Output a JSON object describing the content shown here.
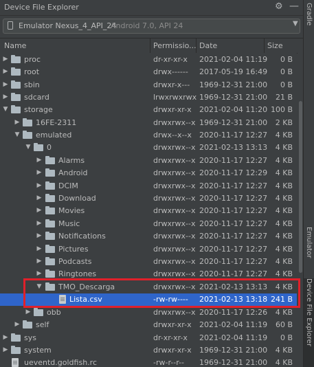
{
  "panel": {
    "title": "Device File Explorer"
  },
  "device": {
    "name": "Emulator Nexus_4_API_24",
    "detail": "Android 7.0, API 24"
  },
  "columns": {
    "name": "Name",
    "permissions": "Permissio...",
    "date": "Date",
    "size": "Size"
  },
  "rows": [
    {
      "name": "proc",
      "perm": "dr-xr-xr-x",
      "date": "2021-02-04 11:19",
      "size": "0 B"
    },
    {
      "name": "root",
      "perm": "drwx------",
      "date": "2017-05-19 16:49",
      "size": "0 B"
    },
    {
      "name": "sbin",
      "perm": "drwxr-x---",
      "date": "1969-12-31 21:00",
      "size": "0 B"
    },
    {
      "name": "sdcard",
      "perm": "lrwxrwxrwx",
      "date": "1969-12-31 21:00",
      "size": "21 B"
    },
    {
      "name": "storage",
      "perm": "drwxr-xr-x",
      "date": "2021-02-04 11:20",
      "size": "100 B"
    },
    {
      "name": "16FE-2311",
      "perm": "drwxrwx--x",
      "date": "1969-12-31 21:00",
      "size": "2 KB"
    },
    {
      "name": "emulated",
      "perm": "drwx--x--x",
      "date": "2020-11-17 12:27",
      "size": "4 KB"
    },
    {
      "name": "0",
      "perm": "drwxrwx--x",
      "date": "2021-02-13 13:13",
      "size": "4 KB"
    },
    {
      "name": "Alarms",
      "perm": "drwxrwx--x",
      "date": "2020-11-17 12:27",
      "size": "4 KB"
    },
    {
      "name": "Android",
      "perm": "drwxrwx--x",
      "date": "2020-11-17 12:29",
      "size": "4 KB"
    },
    {
      "name": "DCIM",
      "perm": "drwxrwx--x",
      "date": "2020-11-17 12:27",
      "size": "4 KB"
    },
    {
      "name": "Download",
      "perm": "drwxrwx--x",
      "date": "2020-11-17 12:27",
      "size": "4 KB"
    },
    {
      "name": "Movies",
      "perm": "drwxrwx--x",
      "date": "2020-11-17 12:27",
      "size": "4 KB"
    },
    {
      "name": "Music",
      "perm": "drwxrwx--x",
      "date": "2020-11-17 12:27",
      "size": "4 KB"
    },
    {
      "name": "Notifications",
      "perm": "drwxrwx--x",
      "date": "2020-11-17 12:27",
      "size": "4 KB"
    },
    {
      "name": "Pictures",
      "perm": "drwxrwx--x",
      "date": "2020-11-17 12:27",
      "size": "4 KB"
    },
    {
      "name": "Podcasts",
      "perm": "drwxrwx--x",
      "date": "2020-11-17 12:27",
      "size": "4 KB"
    },
    {
      "name": "Ringtones",
      "perm": "drwxrwx--x",
      "date": "2020-11-17 12:27",
      "size": "4 KB"
    },
    {
      "name": "TMO_Descarga",
      "perm": "drwxrwx--x",
      "date": "2021-02-13 13:13",
      "size": "4 KB"
    },
    {
      "name": "Lista.csv",
      "perm": "-rw-rw----",
      "date": "2021-02-13 13:18",
      "size": "241 B"
    },
    {
      "name": "obb",
      "perm": "drwxrwx--x",
      "date": "2020-11-17 12:26",
      "size": "4 KB"
    },
    {
      "name": "self",
      "perm": "drwxr-xr-x",
      "date": "2021-02-04 11:19",
      "size": "60 B"
    },
    {
      "name": "sys",
      "perm": "dr-xr-xr-x",
      "date": "2021-02-04 11:19",
      "size": "0 B"
    },
    {
      "name": "system",
      "perm": "drwxr-xr-x",
      "date": "1969-12-31 21:00",
      "size": "4 KB"
    },
    {
      "name": "ueventd.goldfish.rc",
      "perm": "-rw-r--r--",
      "date": "1969-12-31 21:00",
      "size": "4 KB"
    }
  ],
  "side_tabs": {
    "gradle": "Gradle",
    "emulator": "Emulator",
    "explorer": "Device File Explorer"
  },
  "colors": {
    "background": "#3c3f41",
    "selection": "#2f65ca",
    "highlight_box": "#e0202a"
  }
}
